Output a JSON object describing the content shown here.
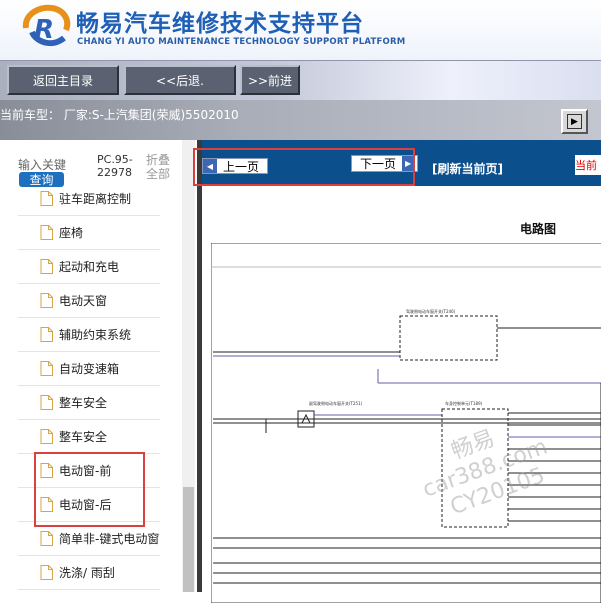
{
  "header": {
    "title_cn": "畅易汽车维修技术支持平台",
    "title_en": "CHANG YI AUTO MAINTENANCE TECHNOLOGY SUPPORT PLATFORM"
  },
  "nav": {
    "home": "返回主目录",
    "back": "<<后退.",
    "forward": ">>前进"
  },
  "vehicle": {
    "label": "当前车型：  厂家:S-上汽集团(荣威)5502010"
  },
  "sidebar": {
    "search_label": "输入关键",
    "search_button": "查询",
    "pc_code": "PC.95-\n22978",
    "collapse": "折叠全部",
    "items": [
      {
        "label": "驻车距离控制"
      },
      {
        "label": "座椅"
      },
      {
        "label": "起动和充电"
      },
      {
        "label": "电动天窗"
      },
      {
        "label": "辅助约束系统"
      },
      {
        "label": "自动变速箱"
      },
      {
        "label": "整车安全"
      },
      {
        "label": "整车安全"
      },
      {
        "label": "电动窗-前"
      },
      {
        "label": "电动窗-后"
      },
      {
        "label": "简单非-键式电动窗"
      },
      {
        "label": "洗涤/ 雨刮"
      }
    ]
  },
  "toolbar": {
    "prev": "上一页",
    "next": "下一页",
    "refresh": "[刷新当前页]",
    "red_tab": "当前"
  },
  "diagram": {
    "title": "电路图",
    "labels": {
      "sw1": "驾驶侧电动车窗开关(T246)",
      "sw2": "副驾驶侧电动车窗开关(T251)",
      "bcm": "车身控制单元(T189)"
    }
  },
  "watermark": {
    "line1": "畅易",
    "line2": "car388.com",
    "line3": "CY20105"
  },
  "colors": {
    "toolbar_bg": "#0b4f8d",
    "title_blue": "#1f5fb5",
    "highlight_red": "#d9403f"
  }
}
